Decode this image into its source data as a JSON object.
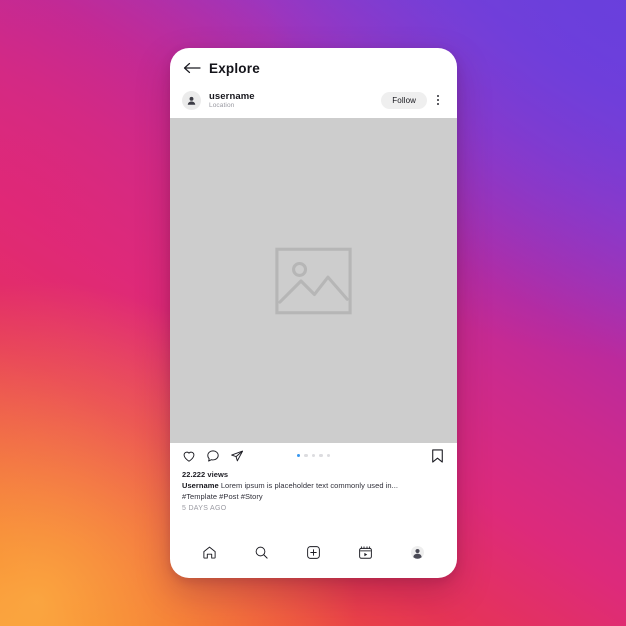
{
  "theme": {
    "gradient_start": "#f58529",
    "gradient_mid": "#dd2a7b",
    "gradient_end": "#6a44d6",
    "card_background": "#ffffff",
    "media_placeholder": "#cdcdcd",
    "accent_dot": "#3897f0",
    "follow_button_bg": "#efefef"
  },
  "header": {
    "back_icon": "arrow-left-icon",
    "title": "Explore"
  },
  "post": {
    "avatar_icon": "person-icon",
    "username": "username",
    "location": "Location",
    "follow_label": "Follow",
    "more_icon": "kebab-menu-icon",
    "media": {
      "placeholder_icon": "image-placeholder-icon"
    },
    "actions": {
      "like_icon": "heart-icon",
      "comment_icon": "comment-bubble-icon",
      "share_icon": "paper-plane-icon",
      "save_icon": "bookmark-icon"
    },
    "carousel": {
      "total": 5,
      "active_index": 0
    },
    "views": "22.222 views",
    "caption_author": "Username",
    "caption_text": "Lorem ipsum is placeholder text commonly used in...",
    "hashtags": "#Template #Post #Story",
    "timestamp": "5 DAYS AGO"
  },
  "bottom_nav": {
    "items": [
      {
        "icon": "home-icon",
        "label": "Home"
      },
      {
        "icon": "search-icon",
        "label": "Search"
      },
      {
        "icon": "add-post-icon",
        "label": "Create"
      },
      {
        "icon": "reels-icon",
        "label": "Reels"
      },
      {
        "icon": "profile-icon",
        "label": "Profile"
      }
    ]
  }
}
